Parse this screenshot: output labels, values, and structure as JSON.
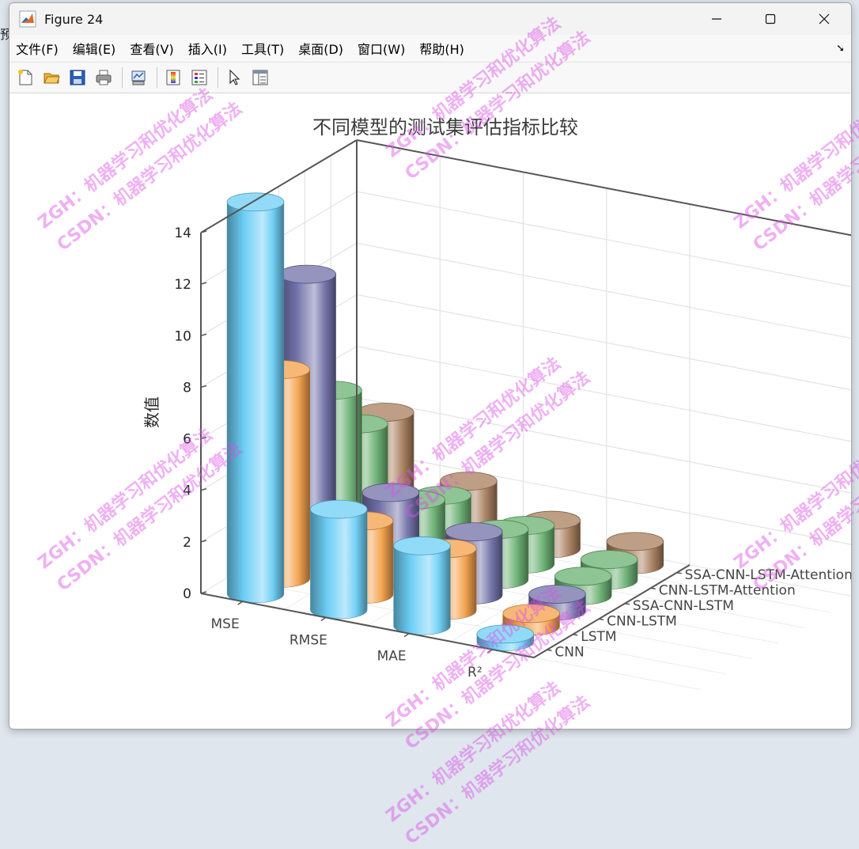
{
  "page": {
    "edge_label": "预"
  },
  "window": {
    "title": "Figure 24"
  },
  "menu": [
    {
      "label": "文件(F)"
    },
    {
      "label": "编辑(E)"
    },
    {
      "label": "查看(V)"
    },
    {
      "label": "插入(I)"
    },
    {
      "label": "工具(T)"
    },
    {
      "label": "桌面(D)"
    },
    {
      "label": "窗口(W)"
    },
    {
      "label": "帮助(H)"
    }
  ],
  "toolbar": [
    {
      "icon": "new-figure-icon"
    },
    {
      "icon": "open-file-icon"
    },
    {
      "icon": "save-icon"
    },
    {
      "icon": "print-icon"
    },
    {
      "icon": "link-plot-icon"
    },
    {
      "icon": "insert-colorbar-icon"
    },
    {
      "icon": "insert-legend-icon"
    },
    {
      "icon": "edit-plot-arrow-icon"
    },
    {
      "icon": "property-editor-icon"
    }
  ],
  "watermark": {
    "line1": "ZGH：机器学习和优化算法",
    "line2": "CSDN：机器学习和优化算法"
  },
  "chart_data": {
    "type": "bar3",
    "title": "不同模型的测试集评估指标比较",
    "xlabel": "",
    "ylabel": "数值",
    "zlim": [
      0,
      14
    ],
    "zticks": [
      0,
      2,
      4,
      6,
      8,
      10,
      12,
      14
    ],
    "grid": true,
    "categories": [
      "MSE",
      "RMSE",
      "MAE",
      "R²"
    ],
    "series": [
      {
        "name": "CNN",
        "color": "#6dcff6",
        "values": [
          15.2,
          3.9,
          3.1,
          0.3
        ]
      },
      {
        "name": "LSTM",
        "color": "#f4a04a",
        "values": [
          8.1,
          2.85,
          2.4,
          0.5
        ]
      },
      {
        "name": "CNN-LSTM",
        "color": "#7070a8",
        "values": [
          11.2,
          3.35,
          2.45,
          0.65
        ]
      },
      {
        "name": "SSA-CNN-LSTM",
        "color": "#6ab072",
        "values": [
          6.1,
          2.47,
          1.95,
          0.75
        ]
      },
      {
        "name": "CNN-LSTM-Attention",
        "color": "#6ab072",
        "values": [
          4.2,
          2.05,
          1.5,
          0.8
        ]
      },
      {
        "name": "SSA-CNN-LSTM-Attention",
        "color": "#a87f5e",
        "values": [
          4.05,
          2.0,
          1.1,
          0.9
        ]
      }
    ]
  }
}
